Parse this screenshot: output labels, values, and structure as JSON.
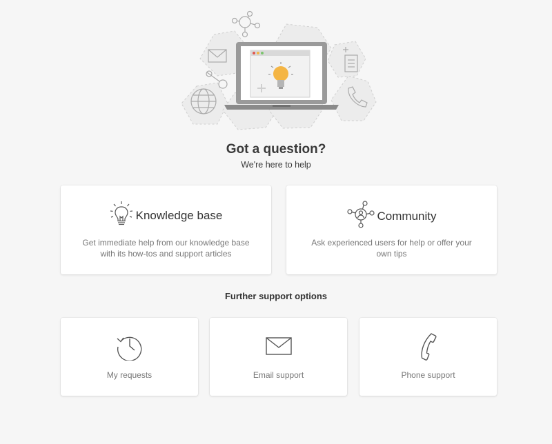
{
  "hero": {
    "icon": "laptop-lightbulb-illustration"
  },
  "header": {
    "title": "Got a question?",
    "subtitle": "We're here to help"
  },
  "main_cards": [
    {
      "title": "Knowledge base",
      "description": "Get immediate help from our knowledge base with its how-tos and support articles",
      "icon": "lightbulb-icon"
    },
    {
      "title": "Community",
      "description": "Ask experienced users for help or offer your own tips",
      "icon": "community-network-icon"
    }
  ],
  "further": {
    "heading": "Further support options",
    "options": [
      {
        "label": "My requests",
        "icon": "history-icon"
      },
      {
        "label": "Email support",
        "icon": "envelope-icon"
      },
      {
        "label": "Phone support",
        "icon": "phone-icon"
      }
    ]
  },
  "colors": {
    "background": "#f6f6f6",
    "card": "#ffffff",
    "accent_bulb": "#f4b544",
    "icon_stroke": "#555555"
  }
}
